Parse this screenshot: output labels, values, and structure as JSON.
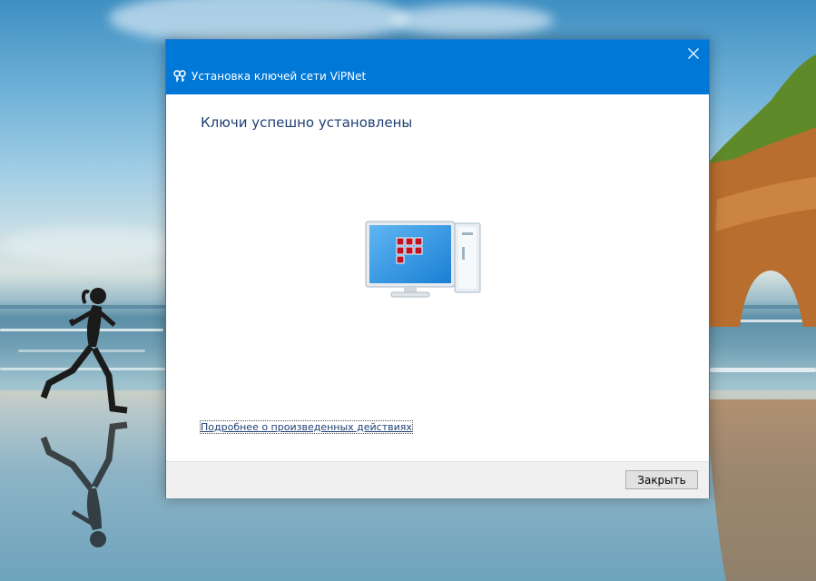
{
  "dialog": {
    "title": "Установка ключей сети ViPNet",
    "heading": "Ключи успешно установлены",
    "details_link": "Подробнее о произведенных действиях",
    "close_button": "Закрыть"
  },
  "icons": {
    "title_icon": "keys-icon",
    "close_icon": "close-icon",
    "hero_icon": "computer-icon"
  },
  "colors": {
    "titlebar": "#0078d7",
    "heading_text": "#1e3f73",
    "footer": "#f0f0f0",
    "vipnet_red": "#c1121f"
  }
}
